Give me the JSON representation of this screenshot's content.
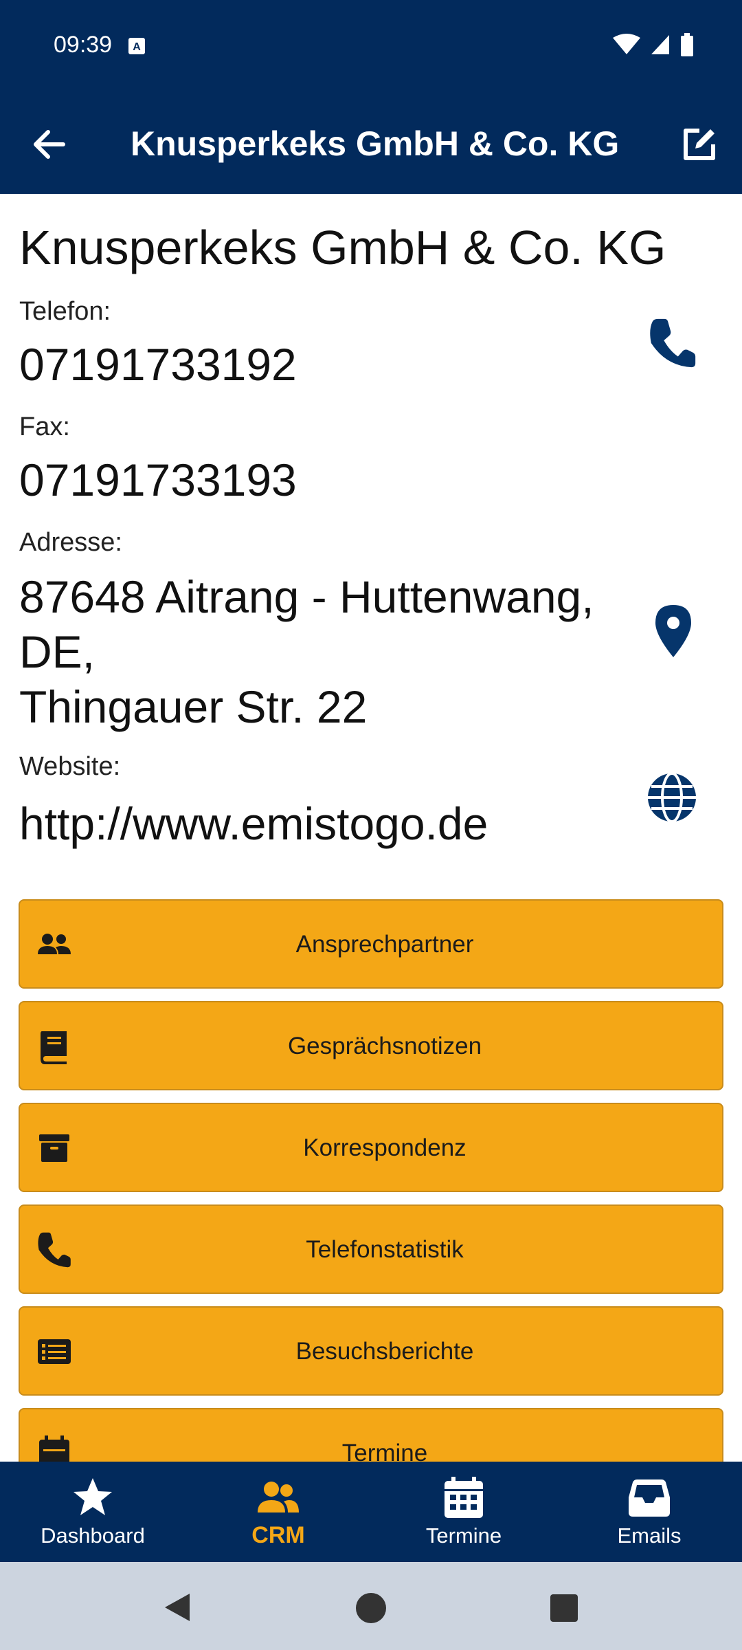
{
  "colors": {
    "navy": "#022a5c",
    "accent": "#f4a716",
    "icon_dark": "#06356b"
  },
  "status": {
    "time": "09:39"
  },
  "appbar": {
    "title": "Knusperkeks GmbH & Co. KG",
    "back_icon": "arrow-left-icon",
    "edit_icon": "edit-icon"
  },
  "company": {
    "name": "Knusperkeks GmbH & Co. KG",
    "phone_label": "Telefon:",
    "phone": "07191733192",
    "fax_label": "Fax:",
    "fax": "07191733193",
    "address_label": "Adresse:",
    "address_line1": "87648 Aitrang - Huttenwang,",
    "address_line2": "DE,",
    "address_line3": "Thingauer Str. 22",
    "website_label": "Website:",
    "website": "http://www.emistogo.de"
  },
  "actions": [
    {
      "label": "Ansprechpartner",
      "icon": "users-icon"
    },
    {
      "label": "Gesprächsnotizen",
      "icon": "book-icon"
    },
    {
      "label": "Korrespondenz",
      "icon": "archive-icon"
    },
    {
      "label": "Telefonstatistik",
      "icon": "phone-icon"
    },
    {
      "label": "Besuchsberichte",
      "icon": "list-icon"
    },
    {
      "label": "Termine",
      "icon": "calendar-icon"
    }
  ],
  "nav": [
    {
      "label": "Dashboard",
      "icon": "star-icon",
      "active": false
    },
    {
      "label": "CRM",
      "icon": "users-icon",
      "active": true
    },
    {
      "label": "Termine",
      "icon": "calendar-icon",
      "active": false
    },
    {
      "label": "Emails",
      "icon": "inbox-icon",
      "active": false
    }
  ]
}
